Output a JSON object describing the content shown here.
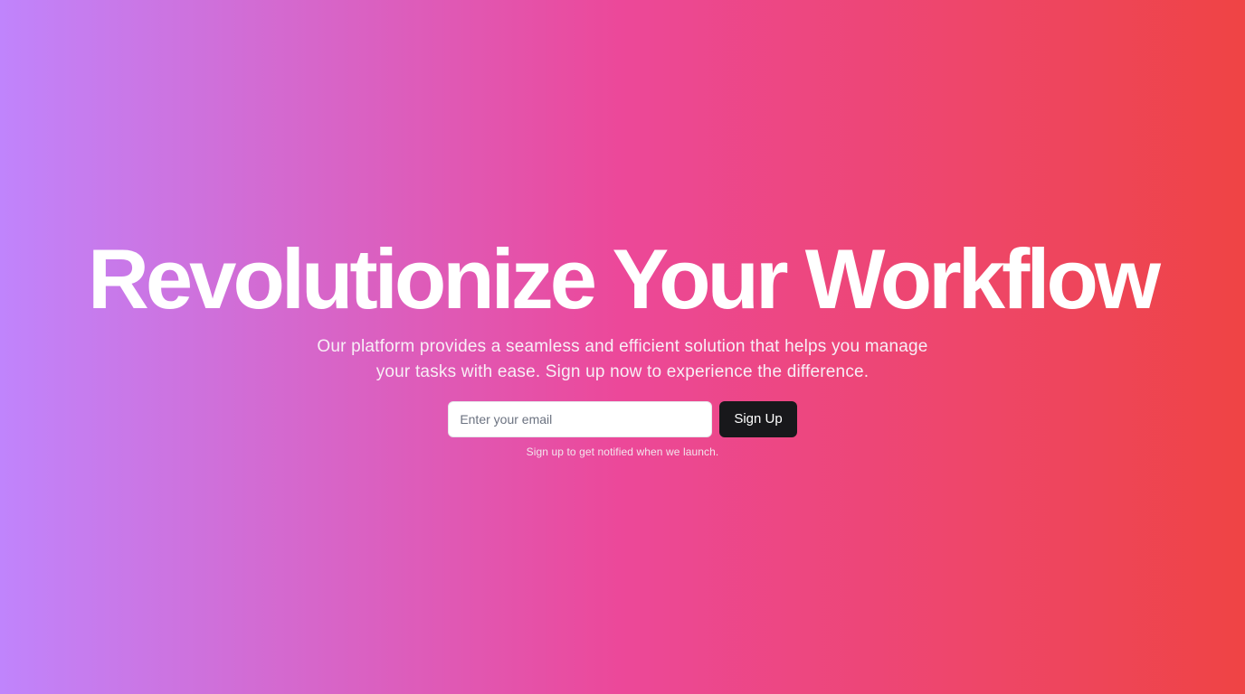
{
  "hero": {
    "title": "Revolutionize Your Workflow",
    "subtitle": "Our platform provides a seamless and efficient solution that helps you manage your tasks with ease. Sign up now to experience the difference."
  },
  "signup": {
    "email_placeholder": "Enter your email",
    "email_value": "",
    "button_label": "Sign Up",
    "note": "Sign up to get notified when we launch."
  },
  "colors": {
    "gradient_start": "#c084fc",
    "gradient_middle": "#ec4899",
    "gradient_end": "#ef4444",
    "button_background": "#18181b",
    "text": "#ffffff"
  }
}
